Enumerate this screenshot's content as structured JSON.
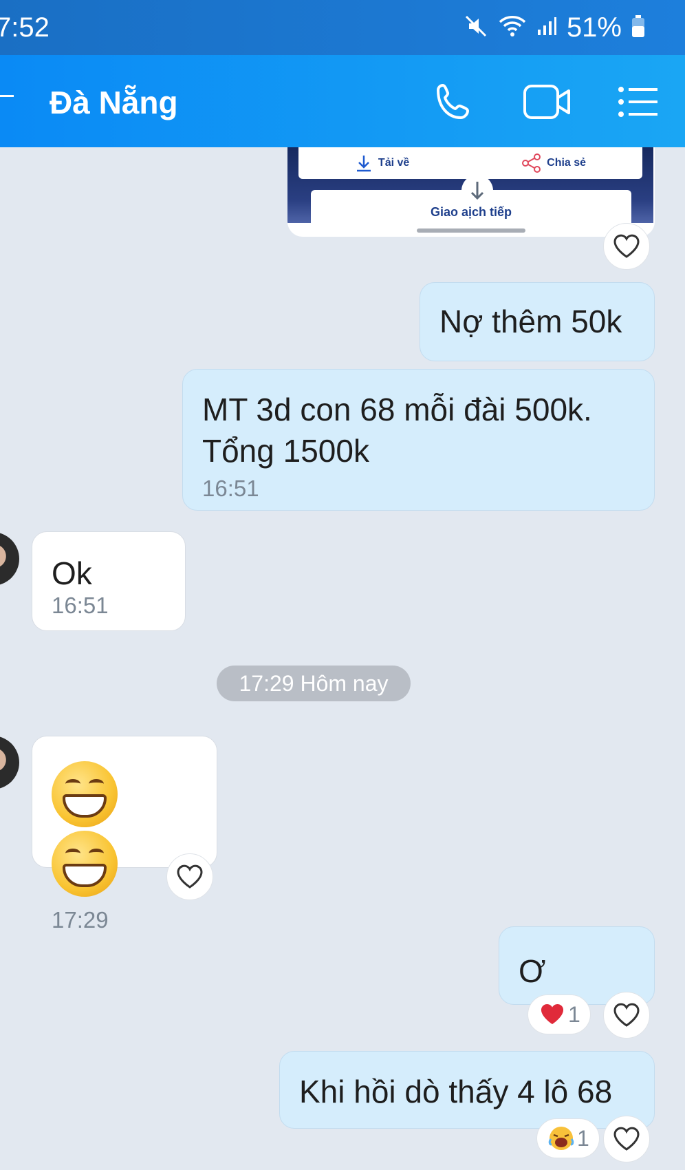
{
  "status_bar": {
    "time": "7:52",
    "battery": "51%"
  },
  "header": {
    "title": "Đà Nẵng"
  },
  "image_card": {
    "download_label": "Tải về",
    "share_label": "Chia sẻ",
    "more_label": "Giao aịch tiếp"
  },
  "messages": [
    {
      "sender": "me",
      "text": "Nợ thêm 50k"
    },
    {
      "sender": "me",
      "text": "MT 3d con 68 mỗi đài 500k. Tổng 1500k",
      "time": "16:51"
    },
    {
      "sender": "them",
      "text": "Ok",
      "time": "16:51"
    },
    {
      "sender": "them",
      "text": "😁 😁",
      "time": "17:29"
    },
    {
      "sender": "me",
      "text": "Ơ",
      "reaction": {
        "emoji": "heart",
        "count": "1"
      }
    },
    {
      "sender": "me",
      "text": "Khi hồi dò thấy 4 lô 68",
      "reaction": {
        "emoji": "crying-laugh",
        "count": "1"
      }
    }
  ],
  "date_separator": "17:29 Hôm nay",
  "colors": {
    "header": "#0a8af5",
    "my_bubble": "#d5edfc",
    "background": "#e2e8f0"
  }
}
